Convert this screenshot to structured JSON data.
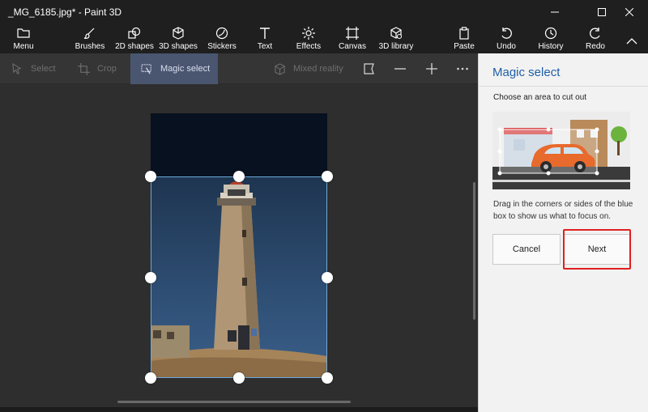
{
  "window": {
    "title": "_MG_6185.jpg* - Paint 3D"
  },
  "ribbon": {
    "menu": "Menu",
    "brushes": "Brushes",
    "shapes2d": "2D shapes",
    "shapes3d": "3D shapes",
    "stickers": "Stickers",
    "text": "Text",
    "effects": "Effects",
    "canvas": "Canvas",
    "library3d": "3D library",
    "paste": "Paste",
    "undo": "Undo",
    "history": "History",
    "redo": "Redo"
  },
  "toolbar": {
    "select": "Select",
    "crop": "Crop",
    "magic_select": "Magic select",
    "mixed_reality": "Mixed reality"
  },
  "panel": {
    "title": "Magic select",
    "instruction": "Choose an area to cut out",
    "description": "Drag in the corners or sides of the blue box to show us what to focus on.",
    "cancel": "Cancel",
    "next": "Next"
  },
  "colors": {
    "accent": "#1f5ea8",
    "highlight": "#e02020",
    "active_tool": "#4a5670"
  }
}
